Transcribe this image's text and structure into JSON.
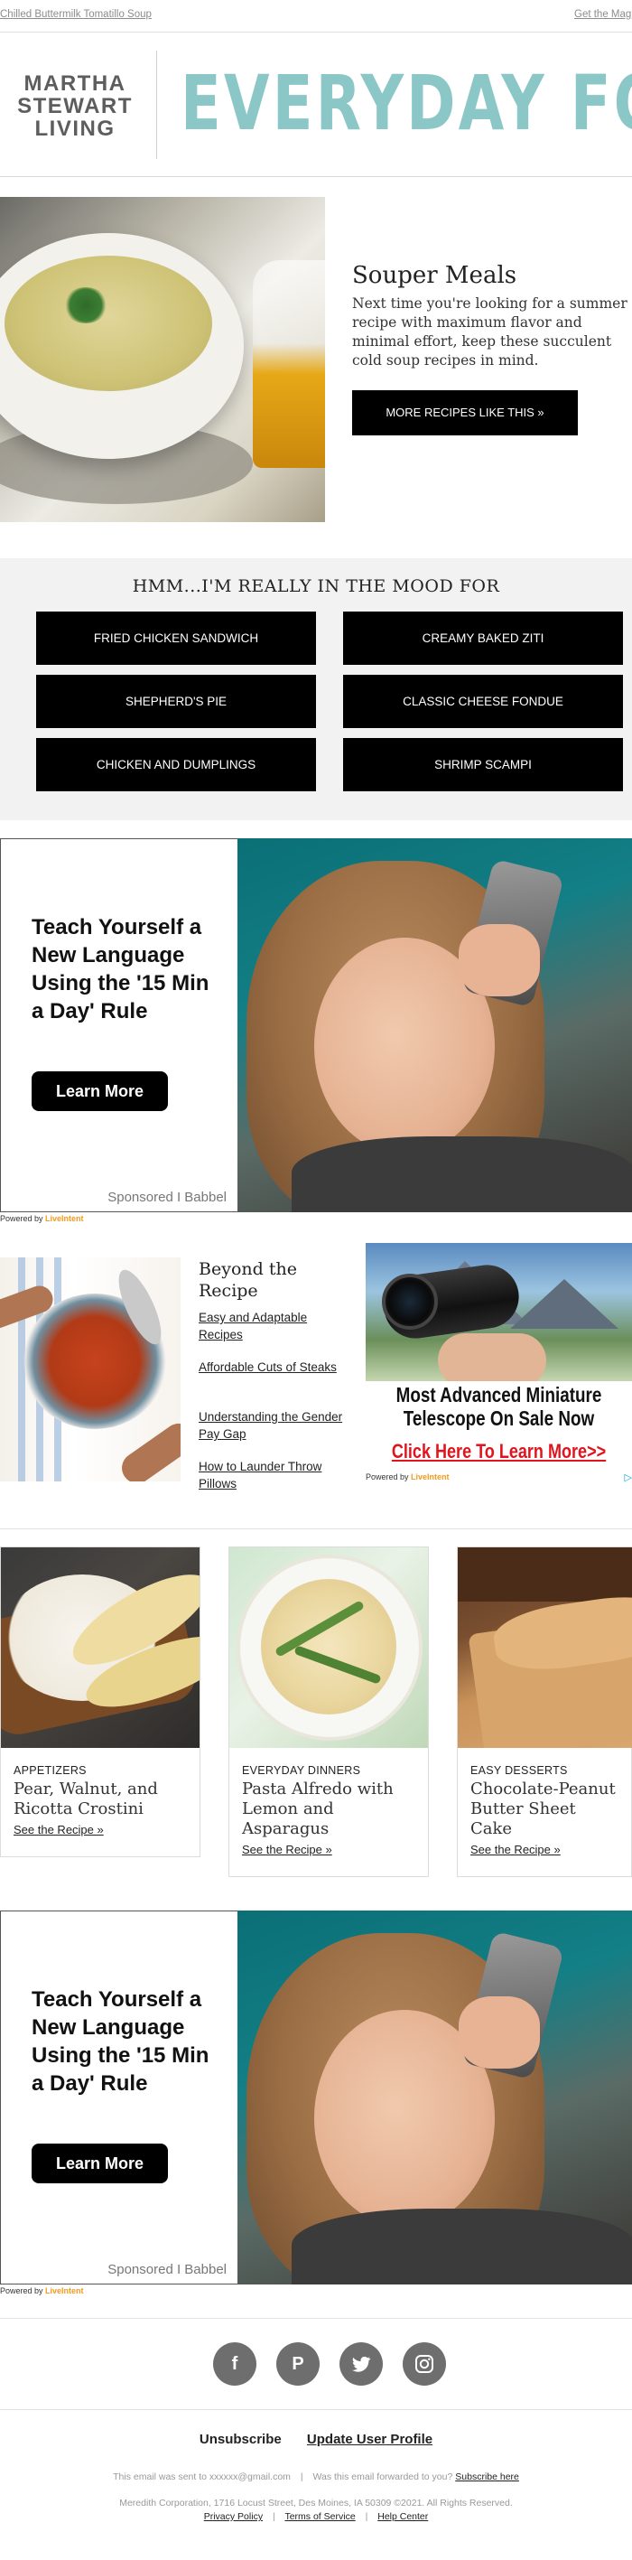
{
  "topbar": {
    "preheader": "Chilled Buttermilk Tomatillo Soup",
    "right_link": "Get the Mag"
  },
  "masthead": {
    "brand_lines": [
      "MARTHA",
      "STEWART",
      "LIVING"
    ],
    "title": "EVERYDAY FOOD"
  },
  "hero": {
    "title": "Souper Meals",
    "text": "Next time you're looking for a summer recipe with maximum flavor and minimal effort, keep these succulent cold soup recipes in mind.",
    "button": "MORE RECIPES LIKE THIS »"
  },
  "mood": {
    "title": "HMM...I'M REALLY IN THE MOOD FOR",
    "buttons": [
      "FRIED CHICKEN SANDWICH",
      "CREAMY BAKED ZITI",
      "SHEPHERD'S PIE",
      "CLASSIC CHEESE FONDUE",
      "CHICKEN AND DUMPLINGS",
      "SHRIMP SCAMPI"
    ]
  },
  "ad_babbel": {
    "headline": "Teach Yourself a New Language Using the '15 Min a Day' Rule",
    "button": "Learn More",
    "sponsor": "Sponsored I Babbel"
  },
  "powered_by": {
    "prefix": "Powered by",
    "brand": "LiveIntent"
  },
  "beyond": {
    "title": "Beyond the Recipe",
    "links": [
      "Easy and Adaptable Recipes",
      "Affordable Cuts of Steaks",
      "Understanding the Gender Pay Gap",
      "How to Launder Throw Pillows"
    ]
  },
  "ad_scope": {
    "headline": "Most Advanced Miniature Telescope On Sale Now",
    "cta": "Click Here To Learn More>>",
    "adchoices": "▷"
  },
  "cards": [
    {
      "category": "APPETIZERS",
      "title": "Pear, Walnut, and Ricotta Crostini",
      "link": "See the Recipe »"
    },
    {
      "category": "EVERYDAY DINNERS",
      "title": "Pasta Alfredo with Lemon and Asparagus",
      "link": "See the Recipe »"
    },
    {
      "category": "EASY DESSERTS",
      "title": "Chocolate-Peanut Butter Sheet Cake",
      "link": "See the Recipe »"
    }
  ],
  "social": {
    "icons": [
      "facebook-icon",
      "pinterest-icon",
      "twitter-icon",
      "instagram-icon"
    ],
    "glyphs": [
      "f",
      "P",
      "",
      ""
    ]
  },
  "footer": {
    "unsubscribe": "Unsubscribe",
    "update_profile": "Update User Profile",
    "sent_to": "This email was sent to xxxxxx@gmail.com",
    "forwarded": "Was this email forwarded to you?",
    "subscribe": "Subscribe here",
    "address": "Meredith Corporation, 1716 Locust Street, Des Moines, IA 50309 ©2021. All Rights Reserved.",
    "privacy": "Privacy Policy",
    "terms": "Terms of Service",
    "help": "Help Center"
  },
  "colors": {
    "accent_teal": "#8cc7c8",
    "button_black": "#000000",
    "livelntent_orange": "#f29b1d",
    "cta_red": "#e0141e"
  }
}
